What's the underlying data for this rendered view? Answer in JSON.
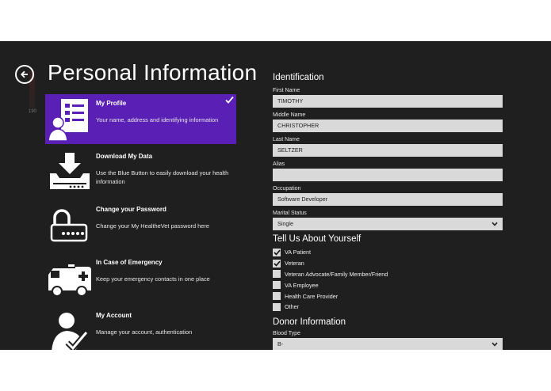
{
  "page": {
    "title": "Personal Information",
    "side_number": "190"
  },
  "menu": [
    {
      "title": "My Profile",
      "desc": "Your name, address and identifying information",
      "icon": "profile-form-icon",
      "active": true
    },
    {
      "title": "Download My Data",
      "desc": "Use the Blue Button to easily download your health information",
      "icon": "download-drive-icon",
      "active": false
    },
    {
      "title": "Change your Password",
      "desc": "Change your My HealtheVet password here",
      "icon": "lock-icon",
      "active": false
    },
    {
      "title": "In Case of Emergency",
      "desc": "Keep your emergency contacts in one place",
      "icon": "ambulance-icon",
      "active": false
    },
    {
      "title": "My Account",
      "desc": "Manage your account, authentication",
      "icon": "user-check-icon",
      "active": false
    }
  ],
  "identification": {
    "heading": "Identification",
    "fields": [
      {
        "label": "First Name",
        "value": "TIMOTHY"
      },
      {
        "label": "Middle Name",
        "value": "CHRISTOPHER"
      },
      {
        "label": "Last Name",
        "value": "SELTZER"
      },
      {
        "label": "Alias",
        "value": ""
      },
      {
        "label": "Occupation",
        "value": "Software Developer"
      }
    ],
    "marital": {
      "label": "Marital Status",
      "value": "Single"
    }
  },
  "about": {
    "heading": "Tell Us About Yourself",
    "options": [
      {
        "label": "VA Patient",
        "checked": true
      },
      {
        "label": "Veteran",
        "checked": true
      },
      {
        "label": "Veteran Advocate/Family Member/Friend",
        "checked": false
      },
      {
        "label": "VA Employee",
        "checked": false
      },
      {
        "label": "Health Care Provider",
        "checked": false
      },
      {
        "label": "Other",
        "checked": false
      }
    ]
  },
  "donor": {
    "heading": "Donor Information",
    "blood": {
      "label": "Blood Type",
      "value": "B-"
    }
  },
  "colors": {
    "background": "#1f1f1f",
    "accent": "#5a1fb5",
    "field": "#d9d9d9"
  }
}
